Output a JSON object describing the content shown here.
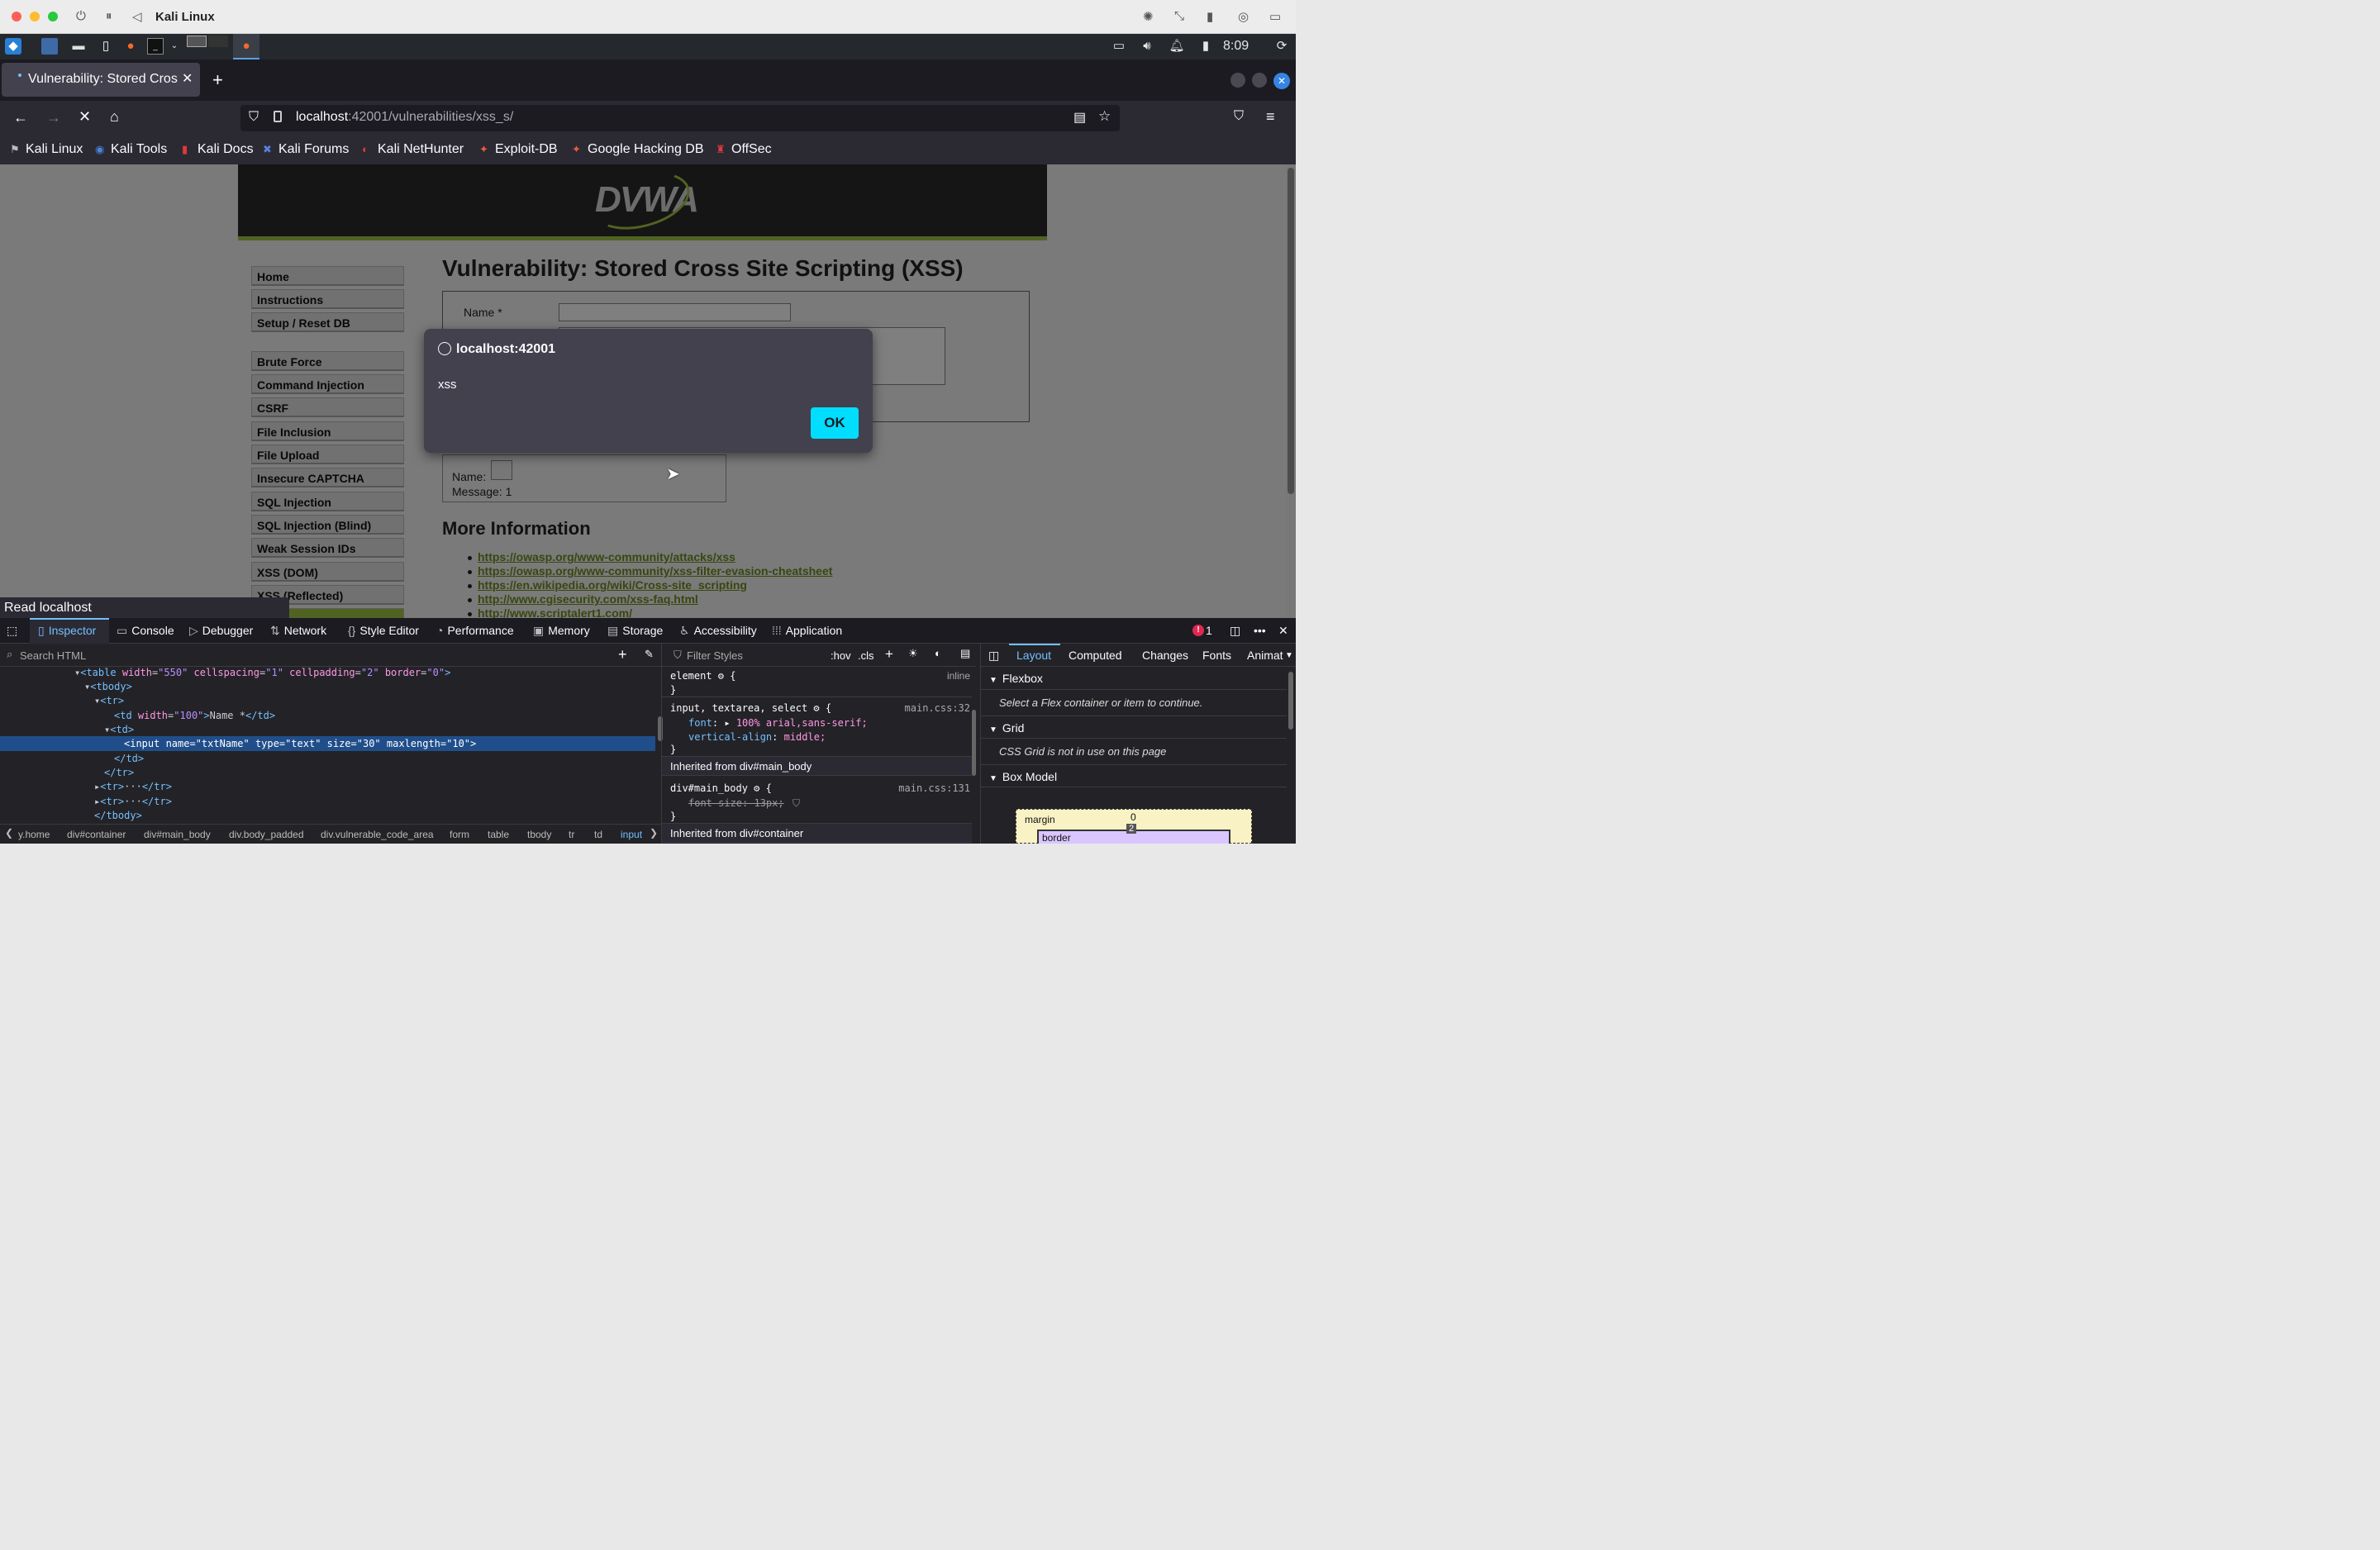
{
  "mac": {
    "title": "Kali Linux"
  },
  "panel": {
    "clock": "8:09"
  },
  "browser": {
    "tab_title": "Vulnerability: Stored Cros",
    "url_host": "localhost",
    "url_rest": ":42001/vulnerabilities/xss_s/",
    "bookmarks": [
      "Kali Linux",
      "Kali Tools",
      "Kali Docs",
      "Kali Forums",
      "Kali NetHunter",
      "Exploit-DB",
      "Google Hacking DB",
      "OffSec"
    ]
  },
  "page": {
    "logo": "DVWA",
    "title": "Vulnerability: Stored Cross Site Scripting (XSS)",
    "menu": [
      "Home",
      "Instructions",
      "Setup / Reset DB",
      "Brute Force",
      "Command Injection",
      "CSRF",
      "File Inclusion",
      "File Upload",
      "Insecure CAPTCHA",
      "SQL Injection",
      "SQL Injection (Blind)",
      "Weak Session IDs",
      "XSS (DOM)",
      "XSS (Reflected)"
    ],
    "name_label": "Name *",
    "entry_name": "Name:",
    "entry_message": "Message: 1",
    "more_info": "More Information",
    "links": [
      "https://owasp.org/www-community/attacks/xss",
      "https://owasp.org/www-community/xss-filter-evasion-cheatsheet",
      "https://en.wikipedia.org/wiki/Cross-site_scripting",
      "http://www.cgisecurity.com/xss-faq.html",
      "http://www.scriptalert1.com/"
    ]
  },
  "dialog": {
    "origin": "localhost:42001",
    "message": "xss",
    "ok": "OK"
  },
  "status": "Read localhost",
  "devtools": {
    "tabs": [
      "Inspector",
      "Console",
      "Debugger",
      "Network",
      "Style Editor",
      "Performance",
      "Memory",
      "Storage",
      "Accessibility",
      "Application"
    ],
    "error_count": "1",
    "search_placeholder": "Search HTML",
    "filter_placeholder": "Filter Styles",
    "hov": ":hov",
    "cls": ".cls",
    "breadcrumbs": [
      "y.home",
      "div#container",
      "div#main_body",
      "div.body_padded",
      "div.vulnerable_code_area",
      "form",
      "table",
      "tbody",
      "tr",
      "td",
      "input"
    ],
    "rules": {
      "element": "element",
      "element_src": "inline",
      "rule1_sel": "input, textarea, select",
      "rule1_src": "main.css:32",
      "font_prop": "font",
      "font_val": "100% arial,sans-serif;",
      "va_prop": "vertical-align",
      "va_val": "middle;",
      "inherit1": "Inherited from div#main_body",
      "rule2_sel": "div#main_body",
      "rule2_src": "main.css:131",
      "fs_decl": "font-size: 13px;",
      "inherit2": "Inherited from div#container"
    },
    "layout_tabs": [
      "Layout",
      "Computed",
      "Changes",
      "Fonts",
      "Animat"
    ],
    "flexbox": "Flexbox",
    "flex_note": "Select a Flex container or item to continue.",
    "grid": "Grid",
    "grid_note": "CSS Grid is not in use on this page",
    "boxmodel": "Box Model",
    "bm_margin": "margin",
    "bm_margin_val": "0",
    "bm_border": "border",
    "bm_border_val": "2"
  }
}
